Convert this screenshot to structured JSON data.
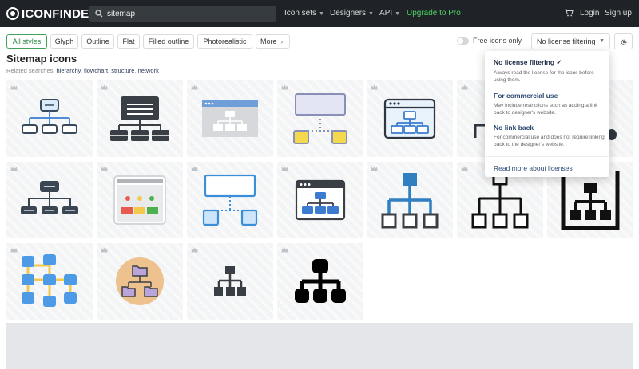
{
  "brand": {
    "name": "ICONFINDER"
  },
  "search": {
    "value": "sitemap"
  },
  "nav": {
    "icon_sets": "Icon sets",
    "designers": "Designers",
    "api": "API",
    "upgrade": "Upgrade to Pro",
    "login": "Login",
    "signup": "Sign up"
  },
  "filters": {
    "styles": [
      "All styles",
      "Glyph",
      "Outline",
      "Flat",
      "Filled outline",
      "Photorealistic",
      "More"
    ],
    "free_icons_only": "Free icons only",
    "license_filter": "No license filtering"
  },
  "page": {
    "title": "Sitemap icons",
    "related_label": "Related searches:",
    "related": [
      "hierarchy",
      "flowchart",
      "structure",
      "network"
    ]
  },
  "license_menu": {
    "options": [
      {
        "title": "No license filtering ✓",
        "desc": "Always read the license for the icons before using them."
      },
      {
        "title": "For commercial use",
        "desc": "May include restrictions such as adding a link back to designer's website."
      },
      {
        "title": "No link back",
        "desc": "For commercial use and does not require linking back to the designer's website."
      }
    ],
    "read_more": "Read more about licenses"
  },
  "colors": {
    "topbar": "#1f2327",
    "accent_green": "#4ed163",
    "link_blue": "#2b4a73"
  },
  "grid": {
    "icons": [
      "sitemap-outline-blue-icon",
      "sitemap-dark-table-icon",
      "website-sitemap-icon",
      "sitemap-flowchart-yellow-icon",
      "browser-sitemap-outline-icon",
      "sitemap-partial-icon",
      "sitemap-partial-dark-icon",
      "sitemap-dark-outline-icon",
      "browser-page-colorful-icon",
      "sitemap-blue-outline-icon",
      "browser-sitemap-dark-icon",
      "hierarchy-blue-icon",
      "hierarchy-black-outline-icon",
      "hierarchy-framed-icon",
      "flowchart-blue-icon",
      "folder-sitemap-circle-icon",
      "hierarchy-small-glyph-icon",
      "hierarchy-large-glyph-icon"
    ]
  }
}
